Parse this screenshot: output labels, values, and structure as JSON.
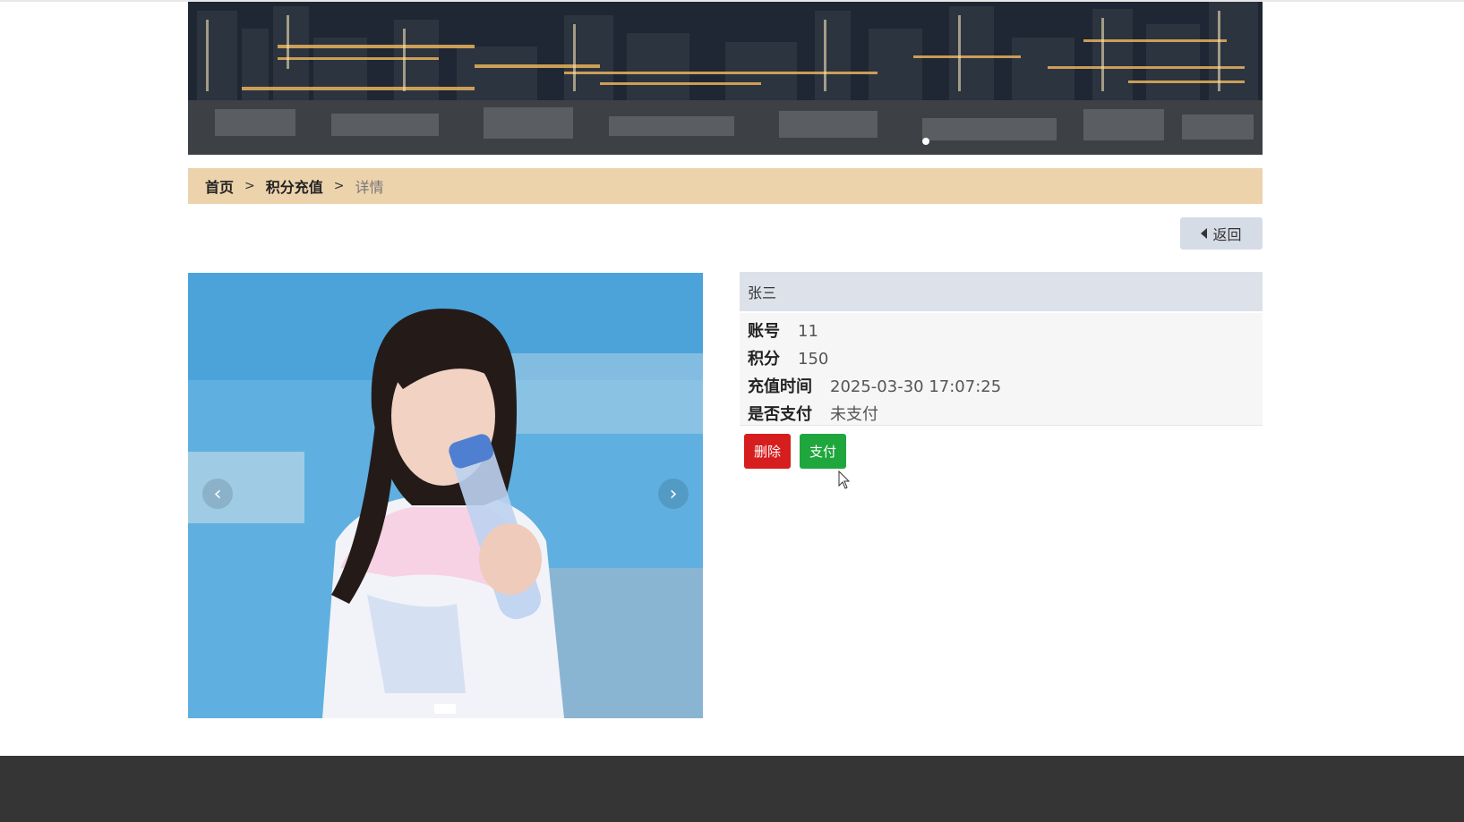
{
  "breadcrumb": {
    "home": "首页",
    "separator": ">",
    "section": "积分充值",
    "current": "详情"
  },
  "actions": {
    "back_label": "返回",
    "delete_label": "删除",
    "pay_label": "支付"
  },
  "detail": {
    "name": "张三",
    "fields": [
      {
        "label": "账号",
        "value": "11"
      },
      {
        "label": "积分",
        "value": "150"
      },
      {
        "label": "充值时间",
        "value": "2025-03-30 17:07:25"
      },
      {
        "label": "是否支付",
        "value": "未支付"
      }
    ]
  },
  "carousel": {
    "prev_icon": "‹",
    "next_icon": "›"
  },
  "colors": {
    "breadcrumb_bg": "#ecd3ac",
    "delete": "#d61e1e",
    "pay": "#1fa73d",
    "footer": "#353535"
  }
}
